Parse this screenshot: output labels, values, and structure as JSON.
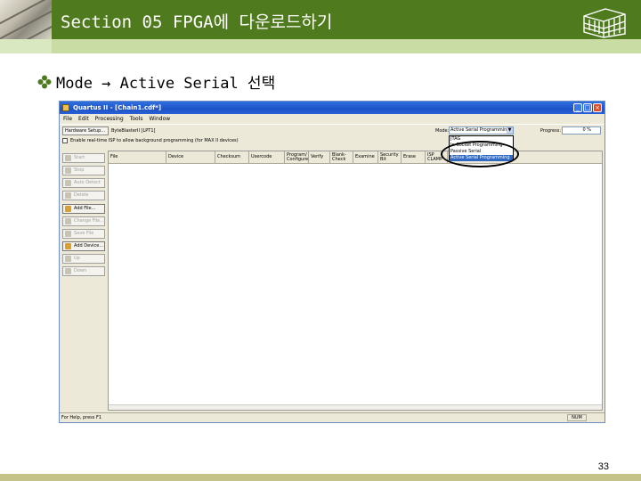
{
  "header": {
    "title": "Section 05 FPGA에 다운로드하기"
  },
  "bullet": {
    "text": "Mode → Active Serial 선택"
  },
  "window": {
    "title": "Quartus II - [Chain1.cdf*]",
    "menu": [
      "File",
      "Edit",
      "Processing",
      "Tools",
      "Window"
    ],
    "hardware_setup_button": "Hardware Setup...",
    "hardware_value": "ByteBlasterII [LPT1]",
    "mode_label": "Mode:",
    "mode_value": "Active Serial Programming",
    "progress_label": "Progress:",
    "progress_value": "0 %",
    "checkbox_label": "Enable real-time ISP to allow background programming (for MAX II devices)",
    "mode_options": [
      "JTAG",
      "In-Socket Programming",
      "Passive Serial",
      "Active Serial Programming"
    ],
    "mode_selected_index": 3,
    "side_buttons": [
      {
        "label": "Start",
        "enabled": false,
        "icon": "play-icon"
      },
      {
        "label": "Stop",
        "enabled": false,
        "icon": "stop-icon"
      },
      {
        "label": "Auto Detect",
        "enabled": false,
        "icon": "detect-icon"
      },
      {
        "label": "Delete",
        "enabled": false,
        "icon": "delete-icon"
      },
      {
        "label": "Add File...",
        "enabled": true,
        "icon": "add-file-icon"
      },
      {
        "label": "Change File...",
        "enabled": false,
        "icon": "change-file-icon"
      },
      {
        "label": "Save File",
        "enabled": false,
        "icon": "save-icon"
      },
      {
        "label": "Add Device...",
        "enabled": true,
        "icon": "add-device-icon"
      },
      {
        "label": "Up",
        "enabled": false,
        "icon": "up-icon"
      },
      {
        "label": "Down",
        "enabled": false,
        "icon": "down-icon"
      }
    ],
    "columns": [
      "File",
      "Device",
      "Checksum",
      "Usercode",
      "Program/ Configure",
      "Verify",
      "Blank-Check",
      "Examine",
      "Security Bit",
      "Erase",
      "ISP CLAMP"
    ],
    "status_text": "For Help, press F1",
    "status_num": "NUM"
  },
  "footer": {
    "page_number": "33"
  }
}
